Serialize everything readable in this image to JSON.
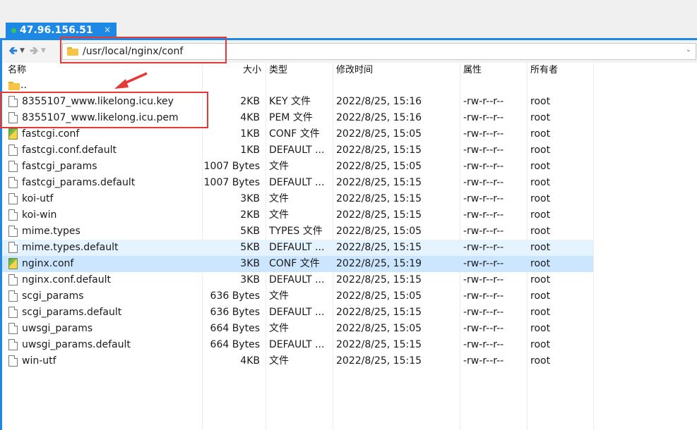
{
  "tab": {
    "title": "47.96.156.51",
    "close": "×"
  },
  "toolbar": {
    "path": "/usr/local/nginx/conf",
    "back_icon": "arrow-left-icon",
    "forward_icon": "arrow-right-icon"
  },
  "columns": {
    "name": "名称",
    "size": "大小",
    "type": "类型",
    "modified": "修改时间",
    "attrs": "属性",
    "owner": "所有者"
  },
  "parent_dir": "..",
  "files": [
    {
      "name": "8355107_www.likelong.icu.key",
      "size": "2KB",
      "type": "KEY 文件",
      "modified": "2022/8/25, 15:16",
      "attrs": "-rw-r--r--",
      "owner": "root",
      "icon": "file-icon"
    },
    {
      "name": "8355107_www.likelong.icu.pem",
      "size": "4KB",
      "type": "PEM 文件",
      "modified": "2022/8/25, 15:16",
      "attrs": "-rw-r--r--",
      "owner": "root",
      "icon": "file-icon"
    },
    {
      "name": "fastcgi.conf",
      "size": "1KB",
      "type": "CONF 文件",
      "modified": "2022/8/25, 15:05",
      "attrs": "-rw-r--r--",
      "owner": "root",
      "icon": "conf-file-icon"
    },
    {
      "name": "fastcgi.conf.default",
      "size": "1KB",
      "type": "DEFAULT ...",
      "modified": "2022/8/25, 15:15",
      "attrs": "-rw-r--r--",
      "owner": "root",
      "icon": "file-icon"
    },
    {
      "name": "fastcgi_params",
      "size": "1007 Bytes",
      "type": "文件",
      "modified": "2022/8/25, 15:05",
      "attrs": "-rw-r--r--",
      "owner": "root",
      "icon": "file-icon"
    },
    {
      "name": "fastcgi_params.default",
      "size": "1007 Bytes",
      "type": "DEFAULT ...",
      "modified": "2022/8/25, 15:15",
      "attrs": "-rw-r--r--",
      "owner": "root",
      "icon": "file-icon"
    },
    {
      "name": "koi-utf",
      "size": "3KB",
      "type": "文件",
      "modified": "2022/8/25, 15:15",
      "attrs": "-rw-r--r--",
      "owner": "root",
      "icon": "file-icon"
    },
    {
      "name": "koi-win",
      "size": "2KB",
      "type": "文件",
      "modified": "2022/8/25, 15:15",
      "attrs": "-rw-r--r--",
      "owner": "root",
      "icon": "file-icon"
    },
    {
      "name": "mime.types",
      "size": "5KB",
      "type": "TYPES 文件",
      "modified": "2022/8/25, 15:05",
      "attrs": "-rw-r--r--",
      "owner": "root",
      "icon": "file-icon"
    },
    {
      "name": "mime.types.default",
      "size": "5KB",
      "type": "DEFAULT ...",
      "modified": "2022/8/25, 15:15",
      "attrs": "-rw-r--r--",
      "owner": "root",
      "icon": "file-icon"
    },
    {
      "name": "nginx.conf",
      "size": "3KB",
      "type": "CONF 文件",
      "modified": "2022/8/25, 15:19",
      "attrs": "-rw-r--r--",
      "owner": "root",
      "icon": "conf-file-icon"
    },
    {
      "name": "nginx.conf.default",
      "size": "3KB",
      "type": "DEFAULT ...",
      "modified": "2022/8/25, 15:15",
      "attrs": "-rw-r--r--",
      "owner": "root",
      "icon": "file-icon"
    },
    {
      "name": "scgi_params",
      "size": "636 Bytes",
      "type": "文件",
      "modified": "2022/8/25, 15:05",
      "attrs": "-rw-r--r--",
      "owner": "root",
      "icon": "file-icon"
    },
    {
      "name": "scgi_params.default",
      "size": "636 Bytes",
      "type": "DEFAULT ...",
      "modified": "2022/8/25, 15:15",
      "attrs": "-rw-r--r--",
      "owner": "root",
      "icon": "file-icon"
    },
    {
      "name": "uwsgi_params",
      "size": "664 Bytes",
      "type": "文件",
      "modified": "2022/8/25, 15:05",
      "attrs": "-rw-r--r--",
      "owner": "root",
      "icon": "file-icon"
    },
    {
      "name": "uwsgi_params.default",
      "size": "664 Bytes",
      "type": "DEFAULT ...",
      "modified": "2022/8/25, 15:15",
      "attrs": "-rw-r--r--",
      "owner": "root",
      "icon": "file-icon"
    },
    {
      "name": "win-utf",
      "size": "4KB",
      "type": "文件",
      "modified": "2022/8/25, 15:15",
      "attrs": "-rw-r--r--",
      "owner": "root",
      "icon": "file-icon"
    }
  ],
  "hover_index": 9,
  "selected_index": 10,
  "colors": {
    "accent": "#1e88e5",
    "annotation": "#e53935",
    "selected": "#cce6ff",
    "hover": "#e5f3ff",
    "folder": "#f7c543"
  }
}
